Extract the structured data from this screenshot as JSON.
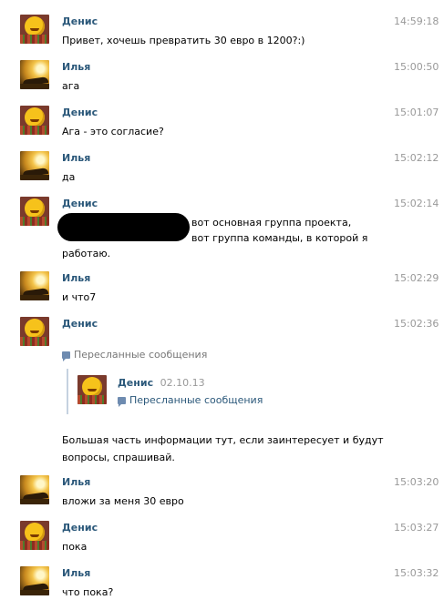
{
  "messages": [
    {
      "author": "Денис",
      "time": "14:59:18",
      "text": "Привет, хочешь превратить 30 евро в 1200?:)"
    },
    {
      "author": "Илья",
      "time": "15:00:50",
      "text": "ага"
    },
    {
      "author": "Денис",
      "time": "15:01:07",
      "text": "Ага - это согласие?"
    },
    {
      "author": "Илья",
      "time": "15:02:12",
      "text": "да"
    },
    {
      "author": "Денис",
      "time": "15:02:14",
      "line1": "вот основная группа проекта,",
      "line2": "вот группа команды, в которой я",
      "line3": "работаю."
    },
    {
      "author": "Илья",
      "time": "15:02:29",
      "text": "и что7"
    },
    {
      "author": "Денис",
      "time": "15:02:36",
      "forwarded_label": "Пересланные сообщения",
      "forwarded": {
        "author": "Денис",
        "date": "02.10.13",
        "forwarded_label": "Пересланные сообщения"
      },
      "line1": "Большая часть информации тут, если заинтересует и будут",
      "line2": "вопросы, спрашивай."
    },
    {
      "author": "Илья",
      "time": "15:03:20",
      "text": "вложи за меня 30 евро"
    },
    {
      "author": "Денис",
      "time": "15:03:27",
      "text": "пока"
    },
    {
      "author": "Илья",
      "time": "15:03:32",
      "text": "что пока?"
    }
  ],
  "colors": {
    "name": "#2b587a",
    "time": "#999999",
    "forward_bar": "#c5d2e0"
  },
  "icons": {
    "forward": "forwarded-messages-icon"
  }
}
